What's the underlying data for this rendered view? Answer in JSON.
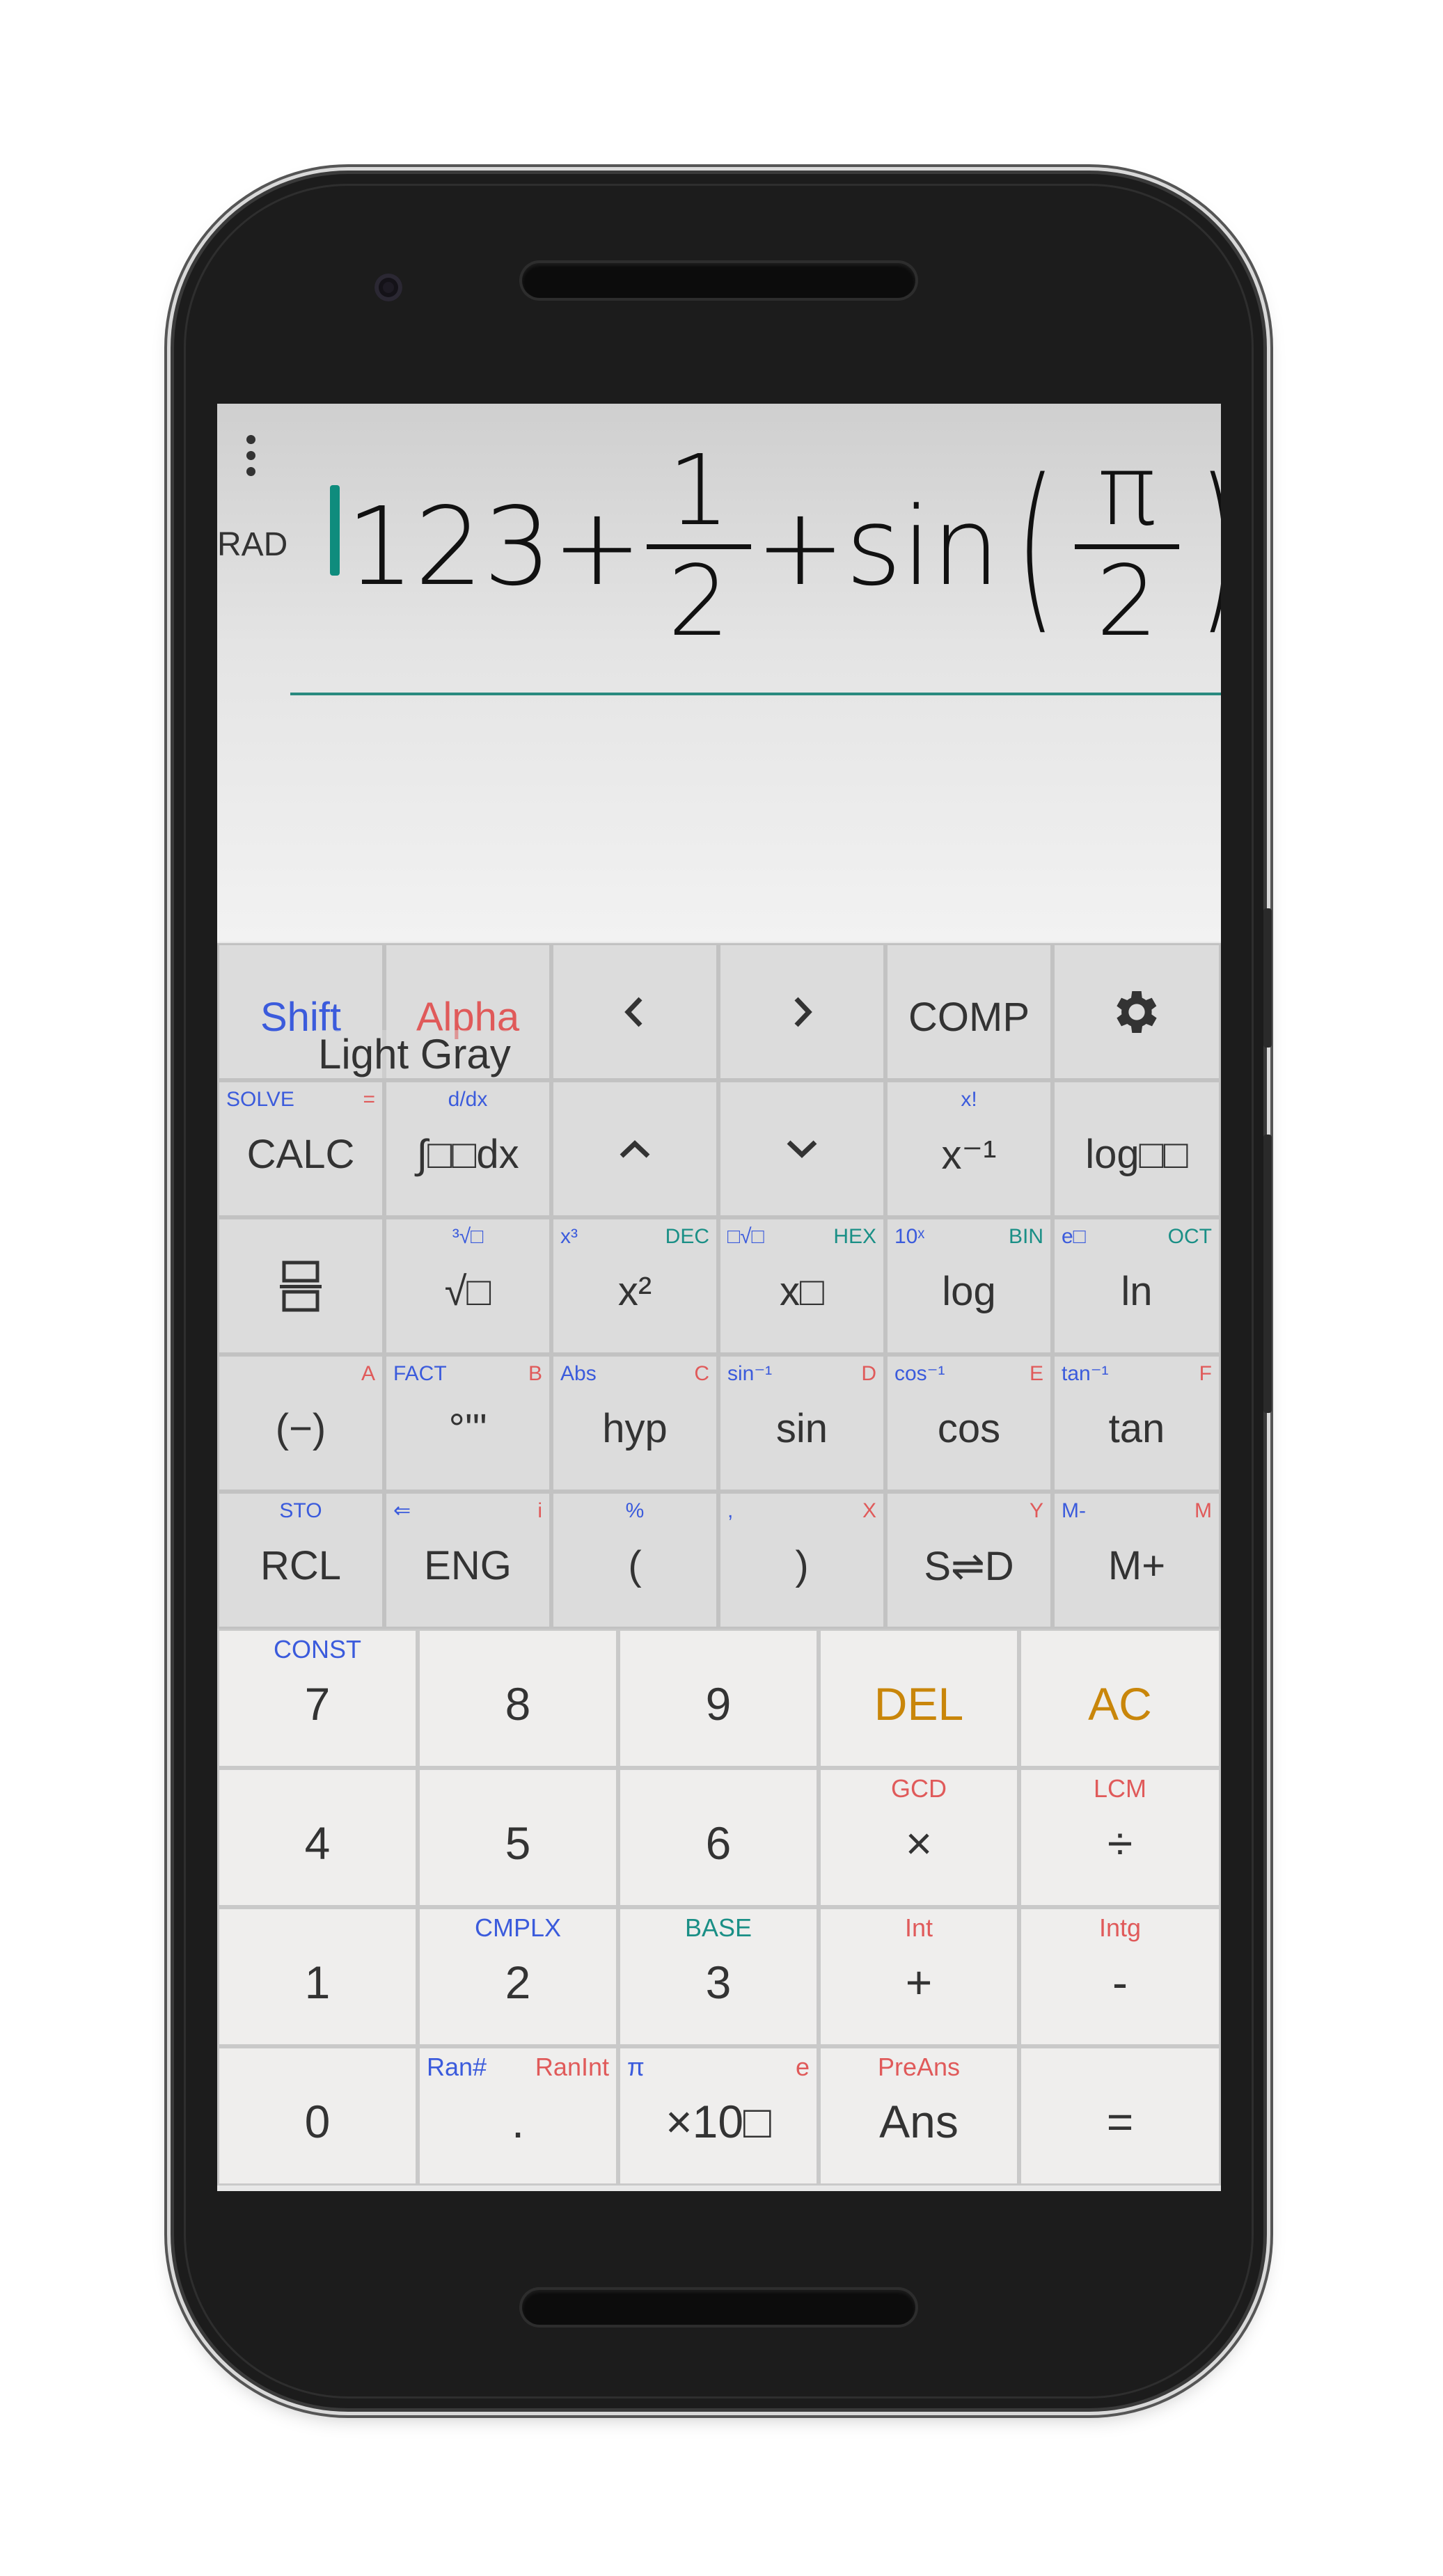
{
  "display": {
    "mode": "RAD",
    "expression": {
      "prefix": "123+",
      "frac1_num": "1",
      "frac1_den": "2",
      "mid": "+sin",
      "frac2_num": "π",
      "frac2_den": "2",
      "open_paren": "(",
      "close_paren": ")"
    }
  },
  "tooltip": "Light Gray",
  "keys": {
    "shift": "Shift",
    "alpha": "Alpha",
    "left": "<",
    "right": ">",
    "comp": "COMP",
    "calc": {
      "label": "CALC",
      "top_left": "SOLVE",
      "top_right": "="
    },
    "integral": {
      "label": "∫□□dx",
      "top": "d/dx"
    },
    "up": "^",
    "down": "v",
    "inverse": {
      "label": "x⁻¹",
      "top": "x!"
    },
    "logbase": {
      "label": "log□□"
    },
    "fraction": {
      "label": "▭"
    },
    "sqrt": {
      "label": "√□",
      "top": "³√□"
    },
    "square": {
      "label": "x²",
      "top_left": "x³",
      "top_right": "DEC"
    },
    "power": {
      "label": "x□",
      "top_left": "□√□",
      "top_right": "HEX"
    },
    "log": {
      "label": "log",
      "top_left": "10ˣ",
      "top_right": "BIN"
    },
    "ln": {
      "label": "ln",
      "top_left": "e□",
      "top_right": "OCT"
    },
    "neg": {
      "label": "(−)",
      "top_right": "A"
    },
    "deg": {
      "label": "°'\"",
      "top_left": "FACT",
      "top_right": "B"
    },
    "hyp": {
      "label": "hyp",
      "top_left": "Abs",
      "top_right": "C"
    },
    "sin": {
      "label": "sin",
      "top_left": "sin⁻¹",
      "top_right": "D"
    },
    "cos": {
      "label": "cos",
      "top_left": "cos⁻¹",
      "top_right": "E"
    },
    "tan": {
      "label": "tan",
      "top_left": "tan⁻¹",
      "top_right": "F"
    },
    "rcl": {
      "label": "RCL",
      "top": "STO"
    },
    "eng": {
      "label": "ENG",
      "top_left": "⇐",
      "top_right": "i"
    },
    "lparen": {
      "label": "(",
      "top": "%"
    },
    "rparen": {
      "label": ")",
      "top_left": ",",
      "top_right": "X"
    },
    "sd": {
      "label": "S⇌D",
      "top_right": "Y"
    },
    "mplus": {
      "label": "M+",
      "top_left": "M-",
      "top_right": "M"
    },
    "n7": {
      "label": "7",
      "top": "CONST"
    },
    "n8": {
      "label": "8"
    },
    "n9": {
      "label": "9"
    },
    "del": {
      "label": "DEL"
    },
    "ac": {
      "label": "AC"
    },
    "n4": {
      "label": "4"
    },
    "n5": {
      "label": "5"
    },
    "n6": {
      "label": "6"
    },
    "mul": {
      "label": "×",
      "top": "GCD"
    },
    "div": {
      "label": "÷",
      "top": "LCM"
    },
    "n1": {
      "label": "1"
    },
    "n2": {
      "label": "2",
      "top": "CMPLX"
    },
    "n3": {
      "label": "3",
      "top": "BASE"
    },
    "add": {
      "label": "+",
      "top": "Int"
    },
    "sub": {
      "label": "-",
      "top": "Intg"
    },
    "n0": {
      "label": "0"
    },
    "dot": {
      "label": ".",
      "top_left": "Ran#",
      "top_right": "RanInt"
    },
    "exp": {
      "label": "×10□",
      "top_left": "π",
      "top_right": "e"
    },
    "ans": {
      "label": "Ans",
      "top": "PreAns"
    },
    "equals": {
      "label": "="
    }
  },
  "colors": {
    "shift_blue": "#3b5bdc",
    "alpha_red": "#e05a5a",
    "teal": "#1a8f86",
    "del_ac_orange": "#c9860a",
    "cursor": "#0f8c7d"
  }
}
